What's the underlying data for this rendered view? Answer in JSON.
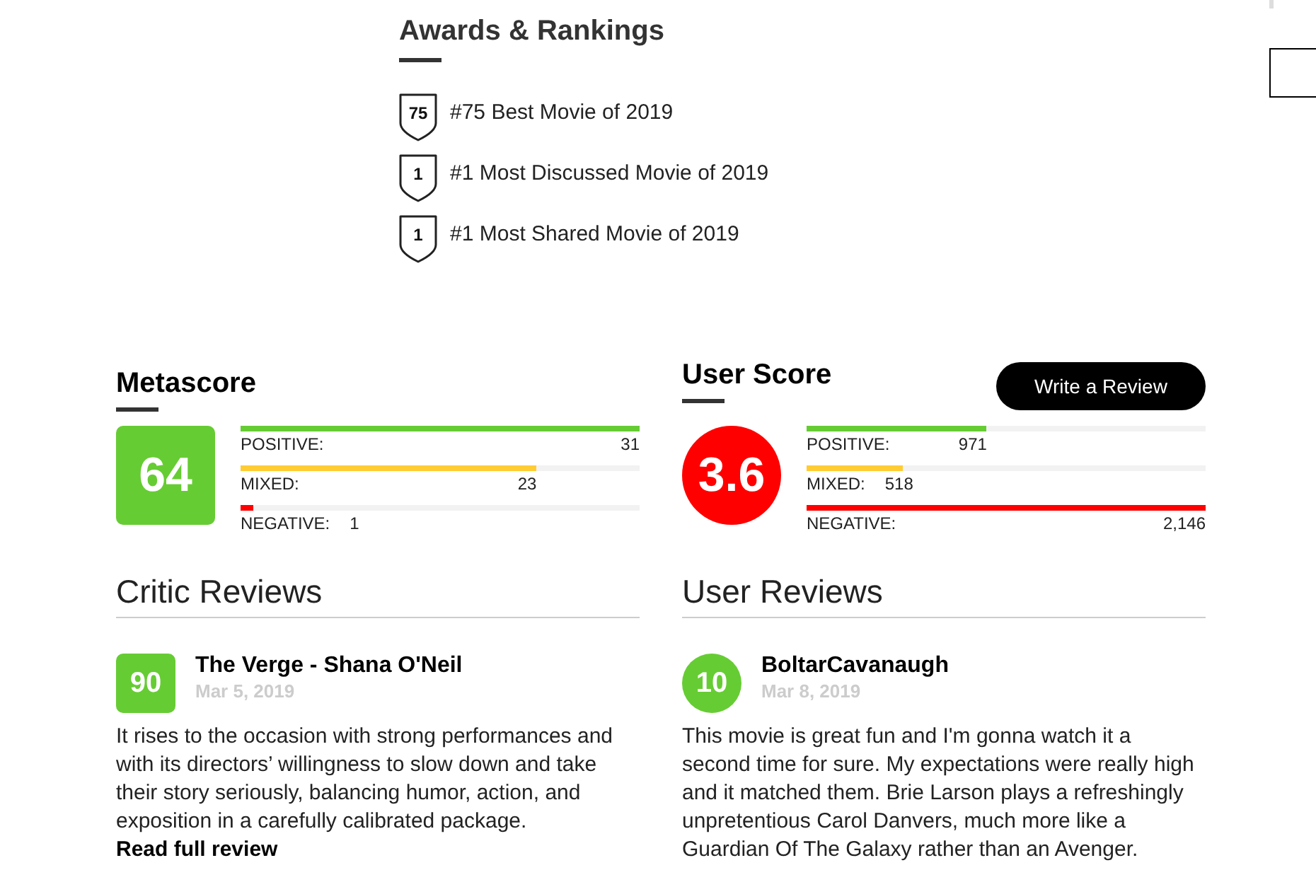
{
  "awards": {
    "title": "Awards & Rankings",
    "items": [
      {
        "rank": "75",
        "text": "#75 Best Movie of 2019"
      },
      {
        "rank": "1",
        "text": "#1 Most Discussed Movie of 2019"
      },
      {
        "rank": "1",
        "text": "#1 Most Shared Movie of 2019"
      }
    ]
  },
  "metascore": {
    "title": "Metascore",
    "score": "64",
    "color": "#66cc33",
    "breakdown": [
      {
        "label": "POSITIVE:",
        "count": "31",
        "level": 1,
        "color": "#66cc33"
      },
      {
        "label": "MIXED:",
        "count": "23",
        "level": 0.742,
        "color": "#ffcc33"
      },
      {
        "label": "NEGATIVE:",
        "count": "1",
        "level": 0.032,
        "color": "#ff0000"
      }
    ]
  },
  "user_score": {
    "title": "User Score",
    "button": "Write a Review",
    "score": "3.6",
    "color": "#ff0000",
    "breakdown": [
      {
        "label": "POSITIVE:",
        "count": "971",
        "level": 0.452,
        "color": "#66cc33"
      },
      {
        "label": "MIXED:",
        "count": "518",
        "level": 0.241,
        "color": "#ffcc33"
      },
      {
        "label": "NEGATIVE:",
        "count": "2,146",
        "level": 1,
        "color": "#ff0000"
      }
    ]
  },
  "critic_reviews": {
    "title": "Critic Reviews",
    "reviews": [
      {
        "score": "90",
        "color": "#66cc33",
        "author": "The Verge - Shana O'Neil",
        "date": "Mar 5, 2019",
        "text": "It rises to the occasion with strong performances and with its directors’ willingness to slow down and take their story seriously, balancing humor, action, and exposition in a carefully calibrated package.",
        "link": "Read full review"
      }
    ]
  },
  "user_reviews": {
    "title": "User Reviews",
    "reviews": [
      {
        "score": "10",
        "color": "#66cc33",
        "author": "BoltarCavanaugh",
        "date": "Mar 8, 2019",
        "text": "This movie is great fun and I'm gonna watch it a second time for sure. My expectations were really high and it matched them. Brie Larson plays a refreshingly unpretentious Carol Danvers, much more like a Guardian Of The Galaxy rather than an Avenger."
      }
    ]
  }
}
